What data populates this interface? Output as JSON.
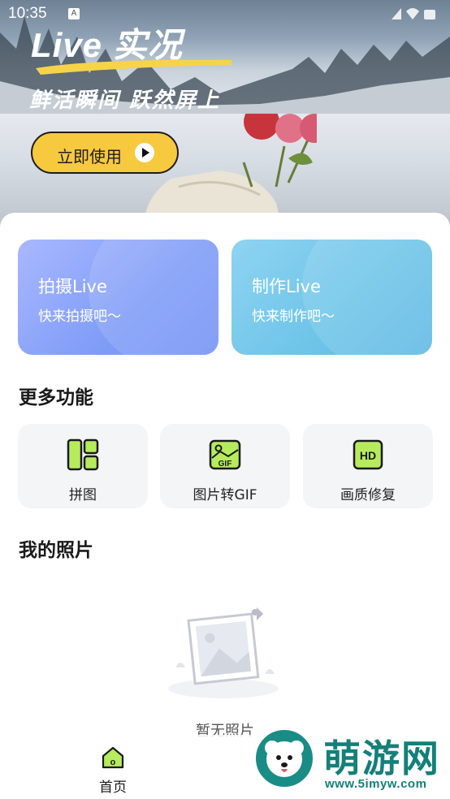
{
  "status_bar": {
    "time": "10:35",
    "notification_badge": "A"
  },
  "hero": {
    "title": "Live 实况",
    "subtitle": "鲜活瞬间 跃然屏上",
    "cta_label": "立即使用",
    "cta_icon": "play-circle-icon",
    "accent_color": "#f7c93e"
  },
  "cards": [
    {
      "title": "拍摄Live",
      "subtitle": "快来拍摄吧～",
      "color": "#8aa5f8"
    },
    {
      "title": "制作Live",
      "subtitle": "快来制作吧～",
      "color": "#6fc4e9"
    }
  ],
  "more_features": {
    "title": "更多功能",
    "tools": [
      {
        "label": "拼图",
        "icon": "collage-icon"
      },
      {
        "label": "图片转GIF",
        "icon": "gif-icon",
        "icon_text": "GIF"
      },
      {
        "label": "画质修复",
        "icon": "hd-icon",
        "icon_text": "HD"
      }
    ],
    "icon_color": "#b6ec5c"
  },
  "my_photos": {
    "title": "我的照片",
    "empty_text": "暂无照片"
  },
  "bottom_nav": {
    "home_label": "首页",
    "home_badge": "o"
  },
  "watermark": {
    "title": "萌游网",
    "url": "www.5imyw.com"
  }
}
